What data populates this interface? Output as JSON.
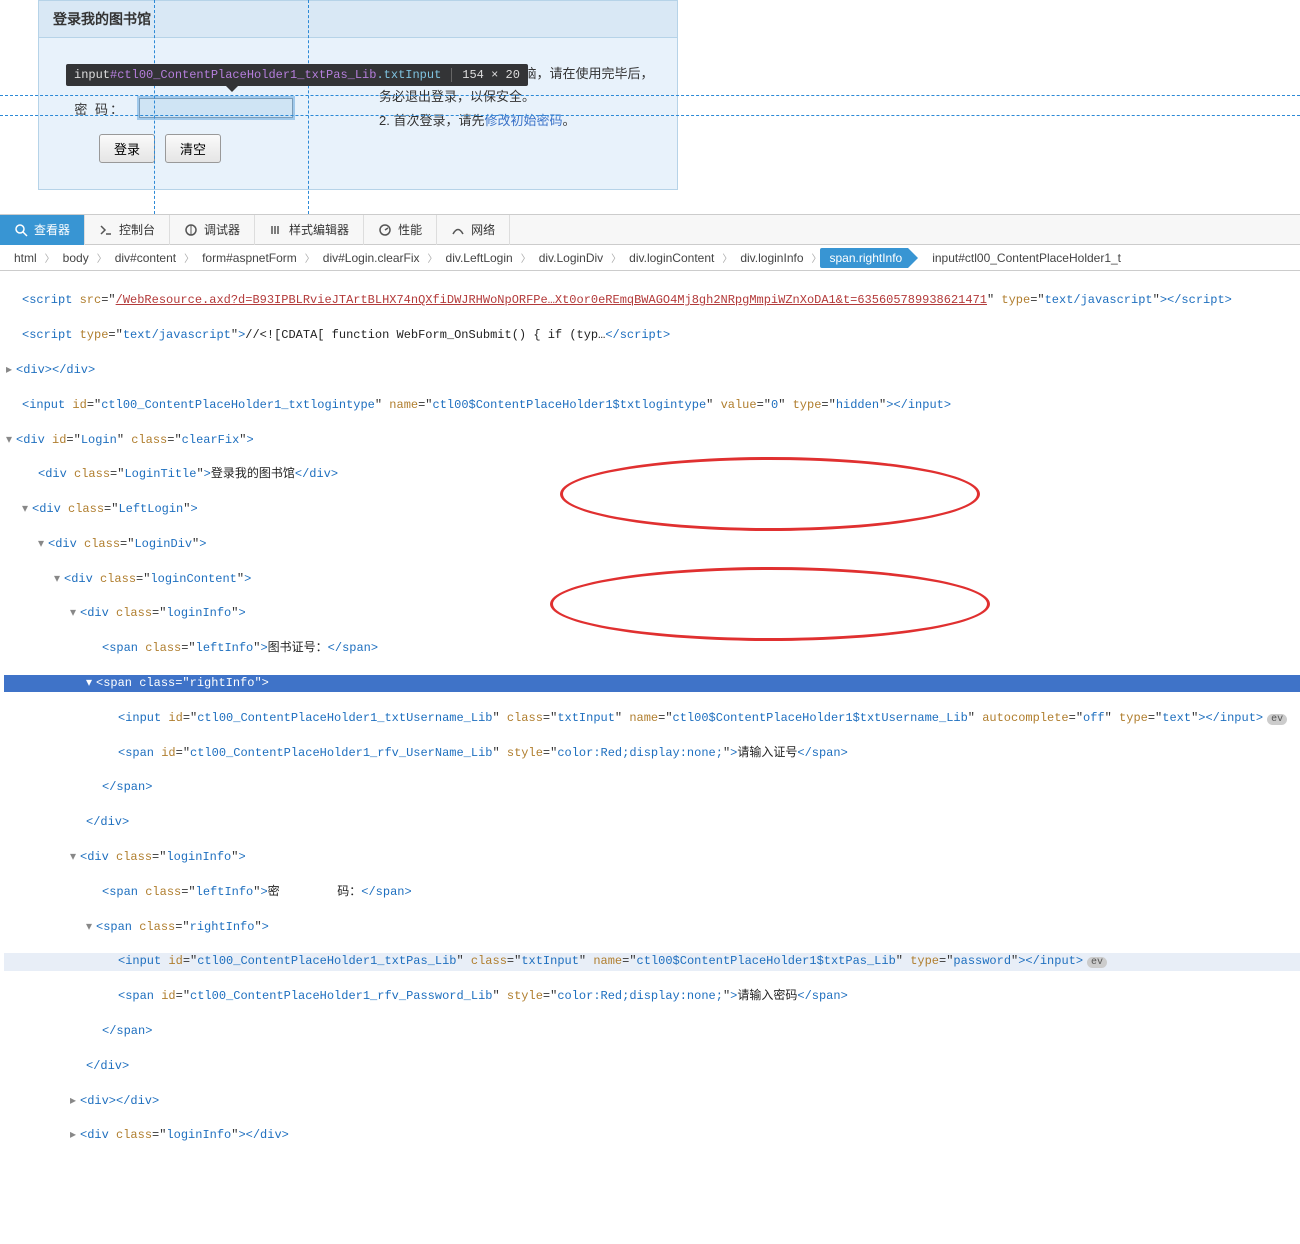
{
  "login": {
    "title": "登录我的图书馆",
    "password_label": "密    码：",
    "login_btn": "登录",
    "clear_btn": "清空",
    "tip_line1": "1. 如果您使用的是公共电脑，请在使用完毕后，",
    "tip_line2": "务必退出登录，以保安全。",
    "tip_line3a": "2. 首次登录，请先",
    "tip_link": "修改初始密码",
    "tip_line3b": "。"
  },
  "tooltip": {
    "sel_prefix": "input",
    "sel_id": "#ctl00_ContentPlaceHolder1_txtPas_Lib",
    "sel_class": ".txtInput",
    "dims": "154 × 20"
  },
  "devtools": {
    "tabs": {
      "inspector": "查看器",
      "console": "控制台",
      "debugger": "调试器",
      "style": "样式编辑器",
      "perf": "性能",
      "network": "网络"
    },
    "breadcrumb": {
      "html": "html",
      "body": "body",
      "content": "div#content",
      "form": "form#aspnetForm",
      "login": "div#Login.clearFix",
      "leftlogin": "div.LeftLogin",
      "logindiv": "div.LoginDiv",
      "logincontent": "div.loginContent",
      "logininfo": "div.loginInfo",
      "rightinfo": "span.rightInfo",
      "input": "input#ctl00_ContentPlaceHolder1_t"
    }
  },
  "code": {
    "script_src": "/WebResource.axd?d=B93IPBLRvieJTArtBLHX74nQXfiDWJRHWoNpORFPe…Xt0or0eREmqBWAGO4Mj8gh2NRpgMmpiWZnXoDA1&t=635605789938621471",
    "script_type": "text/javascript",
    "cdata": "//<![CDATA[ function WebForm_OnSubmit() { if (typ…",
    "hidden_id": "ctl00_ContentPlaceHolder1_txtlogintype",
    "hidden_name": "ctl00$ContentPlaceHolder1$txtlogintype",
    "hidden_value": "0",
    "hidden_type": "hidden",
    "login_id": "Login",
    "clearfix": "clearFix",
    "logintitle_class": "LoginTitle",
    "logintitle_text": "登录我的图书馆",
    "leftlogin": "LeftLogin",
    "logindiv": "LoginDiv",
    "logincontent": "loginContent",
    "logininfo": "loginInfo",
    "leftinfo": "leftInfo",
    "rightinfo": "rightInfo",
    "label_user": "图书证号：",
    "label_pass": "密        码：",
    "user_input_id": "ctl00_ContentPlaceHolder1_txtUsername_Lib",
    "txtinput": "txtInput",
    "user_input_name": "ctl00$ContentPlaceHolder1$txtUsername_Lib",
    "autocomplete": "off",
    "type_text": "text",
    "rfv_user_id": "ctl00_ContentPlaceHolder1_rfv_UserName_Lib",
    "style_hidden": "color:Red;display:none;",
    "rfv_user_text": "请输入证号",
    "pas_input_id": "ctl00_ContentPlaceHolder1_txtPas_Lib",
    "pas_input_name": "ctl00$ContentPlaceHolder1$txtPas_Lib",
    "type_password": "password",
    "rfv_pass_id": "ctl00_ContentPlaceHolder1_rfv_Password_Lib",
    "rfv_pass_text": "请输入密码"
  }
}
